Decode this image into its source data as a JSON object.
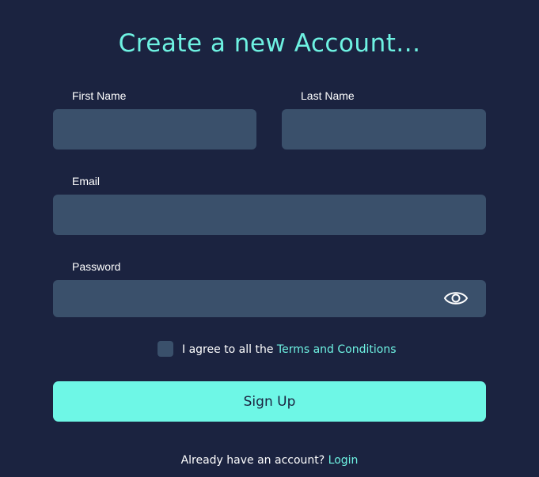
{
  "title": "Create a new Account...",
  "form": {
    "first_name_label": "First Name",
    "first_name_value": "",
    "last_name_label": "Last Name",
    "last_name_value": "",
    "email_label": "Email",
    "email_value": "",
    "password_label": "Password",
    "password_value": "",
    "password_toggle_icon": "eye-icon",
    "agree_prefix": "I agree to all the ",
    "terms_link": "Terms and Conditions",
    "submit_label": "Sign Up"
  },
  "footer": {
    "prompt": "Already have an account? ",
    "login_link": "Login"
  },
  "colors": {
    "background": "#1b2340",
    "accent": "#6ef2e2",
    "field": "#3a506b",
    "button": "#6ef7e6"
  }
}
